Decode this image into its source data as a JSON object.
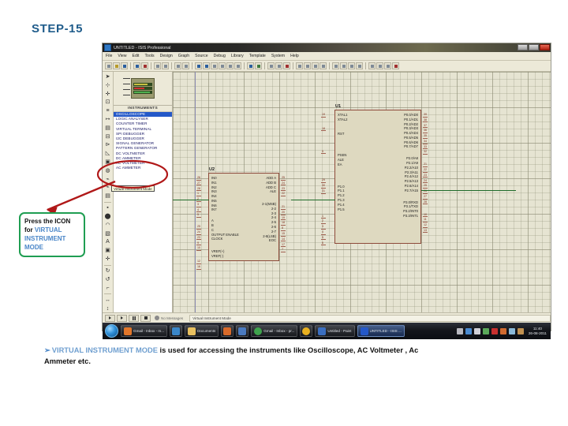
{
  "slide": {
    "heading": "STEP-15",
    "heading_color": "#1f5c8b"
  },
  "callout": {
    "line1": "Press the ICON",
    "line2_prefix": "for ",
    "line2_highlight": "VIRTUAL",
    "line3_highlight": "INSTRUMENT",
    "line4_highlight": "MODE",
    "border_color": "#1f9e52",
    "highlight_color": "#4a86c8"
  },
  "annotation": {
    "ellipse_color": "#b01818",
    "arrow_color": "#b01818"
  },
  "bottom_note": {
    "bullet": "➢",
    "highlight": "VIRTUAL INSTRUMENT MODE",
    "rest_line1": " is used for accessing the instruments like Oscilloscope, AC Voltmeter , Ac",
    "rest_line2": "Ammeter etc.",
    "highlight_color": "#6f9fd0"
  },
  "app": {
    "titlebar": {
      "title": "UNTITLED - ISIS Professional",
      "icon": "isis-app-icon",
      "controls": [
        "minimize-button",
        "maximize-button",
        "close-button"
      ]
    },
    "menu": [
      "File",
      "View",
      "Edit",
      "Tools",
      "Design",
      "Graph",
      "Source",
      "Debug",
      "Library",
      "Template",
      "System",
      "Help"
    ],
    "toolbar_groups": [
      {
        "buttons": [
          "new-file-icon",
          "open-file-icon",
          "save-file-icon"
        ]
      },
      {
        "buttons": [
          "import-icon",
          "export-icon",
          "print-icon",
          "print-area-icon"
        ]
      },
      {
        "buttons": [
          "refresh-icon",
          "grid-toggle-icon",
          "origin-icon",
          "center-icon",
          "zoom-in-icon",
          "zoom-out-icon",
          "zoom-area-icon",
          "zoom-all-icon"
        ]
      },
      {
        "buttons": [
          "undo-icon",
          "redo-icon",
          "cut-icon",
          "copy-icon",
          "paste-icon"
        ]
      },
      {
        "buttons": [
          "block-copy-icon",
          "block-move-icon",
          "block-rotate-icon",
          "block-delete-icon"
        ]
      },
      {
        "buttons": [
          "pick-device-icon",
          "make-device-icon",
          "packaging-tool-icon",
          "decompose-icon"
        ]
      },
      {
        "buttons": [
          "netlist-icon",
          "erc-icon",
          "bom-icon",
          "ares-icon"
        ]
      }
    ],
    "mode_toolbar": [
      "selection-mode-icon",
      "component-mode-icon",
      "junction-dot-mode-icon",
      "wire-label-mode-icon",
      "text-script-mode-icon",
      "buses-mode-icon",
      "subcircuit-mode-icon",
      "terminals-mode-icon",
      "device-pin-mode-icon",
      "graph-mode-icon",
      "tape-recorder-mode-icon",
      "generator-mode-icon",
      "voltage-probe-mode-icon",
      "current-probe-mode-icon",
      "virtual-instrument-mode-icon",
      "2d-box-mode-icon",
      "2d-circle-mode-icon",
      "2d-arc-mode-icon",
      "2d-path-mode-icon",
      "2d-text-mode-icon",
      "2d-symbol-mode-icon",
      "2d-marker-mode-icon",
      "rotate-clockwise-icon",
      "rotate-anticlockwise-icon",
      "rotation-angle-icon",
      "mirror-x-icon",
      "mirror-y-icon"
    ],
    "tooltip": {
      "text": "Virtual Instrument Mode"
    },
    "selector": {
      "header": "INSTRUMENTS",
      "preview_name": "lcd-preview-thumbnail",
      "items": [
        "OSCILLOSCOPE",
        "LOGIC ANALYSER",
        "COUNTER TIMER",
        "VIRTUAL TERMINAL",
        "SPI DEBUGGER",
        "I2C DEBUGGER",
        "SIGNAL GENERATOR",
        "PATTERN GENERATOR",
        "DC VOLTMETER",
        "DC AMMETER",
        "AC VOLTMETER",
        "AC AMMETER"
      ],
      "selected_index": 0
    },
    "schematic": {
      "u1": {
        "ref": "U1",
        "left_pins": [
          "XTAL1",
          "XTAL2",
          "RST",
          "PSEN",
          "ALE",
          "EA",
          "P1.0",
          "P1.1",
          "P1.2",
          "P1.3",
          "P1.4",
          "P1.5"
        ],
        "left_nums": [
          "19",
          "18",
          "9",
          "29",
          "30",
          "31",
          "1",
          "2",
          "3",
          "4",
          "5",
          "6"
        ],
        "right_pins": [
          "P0.0/AD0",
          "P0.1/AD1",
          "P0.2/AD2",
          "P0.3/AD3",
          "P0.4/AD4",
          "P0.5/AD5",
          "P0.6/AD6",
          "P0.7/AD7",
          "P2.0/A8",
          "P2.1/A9",
          "P2.2/A10",
          "P2.3/A11",
          "P2.4/A12",
          "P2.5/A13",
          "P2.6/A14",
          "P2.7/A15",
          "P3.0/RXD",
          "P3.1/TXD",
          "P3.2/INT0",
          "P3.3/INT1",
          "P3.4/T0",
          "P3.5/T1"
        ],
        "right_nums": [
          "39",
          "38",
          "37",
          "36",
          "35",
          "34",
          "33",
          "32",
          "21",
          "22",
          "23",
          "24",
          "25",
          "26",
          "27",
          "28",
          "10",
          "11",
          "12",
          "13",
          "14",
          "15"
        ]
      },
      "u2": {
        "ref": "U2",
        "left_pins": [
          "IN0",
          "IN1",
          "IN2",
          "IN3",
          "IN4",
          "IN5",
          "IN6",
          "IN7",
          "A",
          "B",
          "C",
          "OUTPUT ENABLE",
          "CLOCK",
          "ALE",
          "VREF(+)",
          "VREF(-)"
        ],
        "left_nums": [
          "26",
          "27",
          "28",
          "1",
          "2",
          "3",
          "4",
          "5",
          "25",
          "24",
          "23",
          "9",
          "10",
          "22",
          "12",
          "16"
        ],
        "right_pins": [
          "ADD A",
          "ADD B",
          "ADD C",
          "ALE",
          "2-1(MSB)",
          "2-2",
          "2-3",
          "2-4",
          "2-5",
          "2-6",
          "2-7",
          "2-8(LSB)",
          "EOC"
        ],
        "right_nums": [
          "25",
          "24",
          "23",
          "22",
          "21",
          "20",
          "19",
          "18",
          "8",
          "15",
          "14",
          "17",
          "7"
        ],
        "part": "ADC0808"
      }
    },
    "sim_bar": {
      "buttons": [
        "play-button",
        "step-button",
        "pause-button",
        "stop-button"
      ],
      "message_label": "No Messages",
      "status_text": "Virtual Instrument Mode"
    }
  },
  "taskbar": {
    "start": "start-orb",
    "items": [
      {
        "name": "firefox-taskbar-item",
        "icon_color": "#e2762a",
        "label": "Gmail - Inbox - m..."
      },
      {
        "name": "internet-explorer-taskbar-item",
        "icon_color": "#3a86c8",
        "label": ""
      },
      {
        "name": "explorer-taskbar-item",
        "icon_color": "#e8c060",
        "label": "Documents"
      },
      {
        "name": "media-player-taskbar-item",
        "icon_color": "#d86a2a",
        "label": ""
      },
      {
        "name": "downloads-taskbar-item",
        "icon_color": "#4a7ac0",
        "label": ""
      },
      {
        "name": "chrome-taskbar-item",
        "icon_color": "#3fa34d",
        "label": "Gmail - Inbox - pr..."
      },
      {
        "name": "acrobat-taskbar-item",
        "icon_color": "#e8b020",
        "label": ""
      },
      {
        "name": "paint-taskbar-item",
        "icon_color": "#3a6ec0",
        "label": "Untitled - Paint"
      },
      {
        "name": "isis-taskbar-item",
        "icon_color": "#2458c8",
        "label": "UNTITLED - ISIS ...",
        "active": true
      }
    ],
    "tray_icons": [
      "action-center-icon",
      "network-icon",
      "volume-icon",
      "battery-icon",
      "antivirus-icon",
      "update-icon",
      "sync-icon",
      "safely-remove-icon"
    ],
    "clock_time": "11:40",
    "clock_date": "26-08-2011"
  }
}
